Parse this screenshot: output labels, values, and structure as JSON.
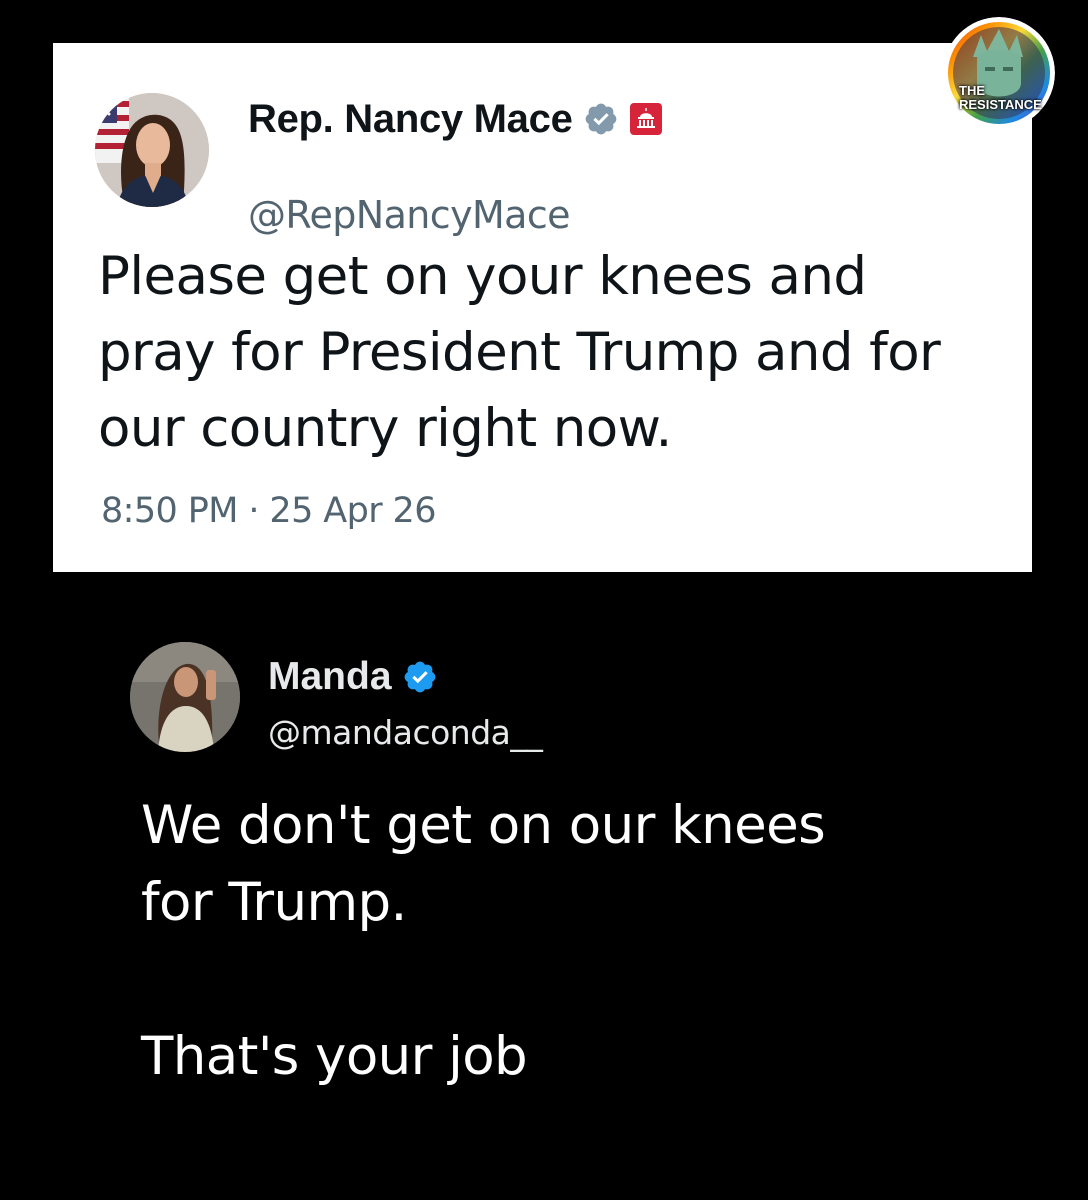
{
  "original_tweet": {
    "display_name": "Rep. Nancy Mace",
    "handle": "@RepNancyMace",
    "verified_badge_icon": "verified-gray-badge-icon",
    "affiliation_badge_icon": "us-capitol-government-badge-icon",
    "text": "Please get on your knees and pray for President Trump and for our country right now.",
    "timestamp": "8:50 PM · 25 Apr 26",
    "colors": {
      "background": "#ffffff",
      "text": "#0f1419",
      "secondary": "#536471",
      "badge_gray": "#829aab",
      "badge_red": "#d6243a"
    }
  },
  "reply_tweet": {
    "display_name": "Manda",
    "handle": "@mandaconda__",
    "verified_badge_icon": "verified-blue-badge-icon",
    "text": "We don't get on our knees\nfor Trump.\n\nThat's your job",
    "colors": {
      "background": "#000000",
      "text": "#ffffff",
      "badge_blue": "#1d9bf0"
    }
  },
  "watermark": {
    "line1": "THE",
    "line2": "RESISTANCE",
    "icon": "statue-of-liberty-rainbow-logo-icon"
  }
}
